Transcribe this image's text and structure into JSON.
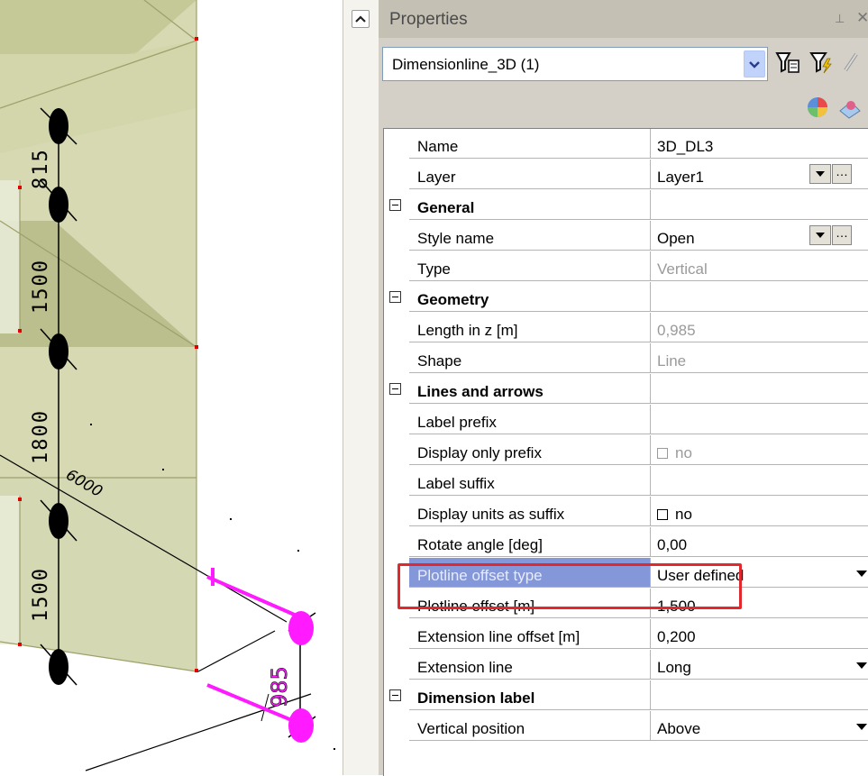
{
  "viewport": {
    "dimensions": [
      "815",
      "1500",
      "1800",
      "1500",
      "6000",
      "985"
    ]
  },
  "panel": {
    "title": "Properties",
    "object_selector": {
      "value": "Dimensionline_3D (1)"
    }
  },
  "rows": [
    {
      "name": "Name",
      "value": "3D_DL3"
    },
    {
      "name": "Layer",
      "value": "Layer1"
    },
    {
      "category": "General"
    },
    {
      "name": "Style name",
      "value": "Open"
    },
    {
      "name": "Type",
      "value": "Vertical",
      "readonly": true
    },
    {
      "category": "Geometry"
    },
    {
      "name": "Length in z [m]",
      "value": "0,985",
      "readonly": true
    },
    {
      "name": "Shape",
      "value": "Line",
      "readonly": true
    },
    {
      "category": "Lines and arrows"
    },
    {
      "name": "Label prefix",
      "value": ""
    },
    {
      "name": "Display only prefix",
      "value": "no",
      "readonly": true
    },
    {
      "name": "Label suffix",
      "value": ""
    },
    {
      "name": "Display units as suffix",
      "value": "no"
    },
    {
      "name": "Rotate angle [deg]",
      "value": "0,00"
    },
    {
      "name": "Plotline offset type",
      "value": "User defined"
    },
    {
      "name": "Plotline offset [m]",
      "value": "1,500"
    },
    {
      "name": "Extension line offset [m]",
      "value": "0,200"
    },
    {
      "name": "Extension line",
      "value": "Long"
    },
    {
      "category": "Dimension label"
    },
    {
      "name": "Vertical position",
      "value": "Above"
    }
  ],
  "colors": {
    "selection": "#8497d8",
    "highlight": "#e0282d",
    "dimension_magenta": "#ff1aff",
    "wall_fill": "#c8cc98"
  }
}
